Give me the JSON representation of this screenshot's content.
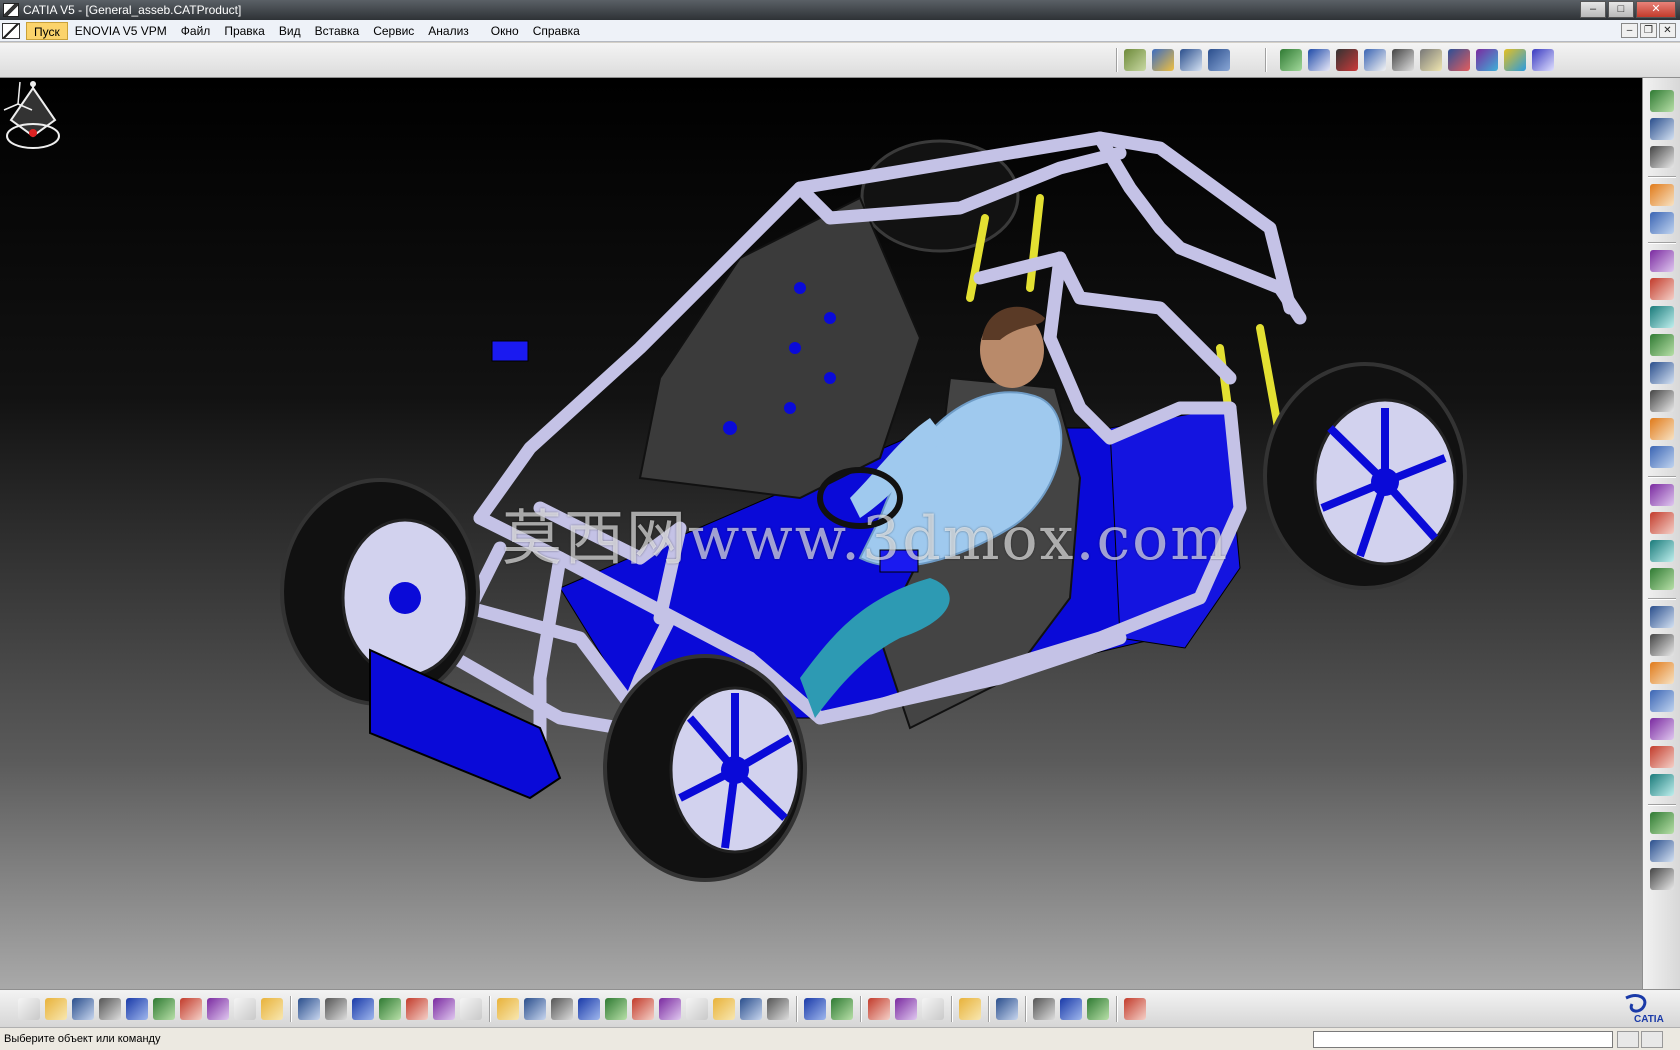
{
  "window": {
    "title": "CATIA V5 - [General_asseb.CATProduct]",
    "controls": {
      "minimize": "–",
      "maximize": "□",
      "close": "✕"
    },
    "mdi_controls": {
      "minimize": "–",
      "restore": "❐",
      "close": "✕"
    }
  },
  "menu": {
    "items": [
      "Пуск",
      "ENOVIA V5 VPM",
      "Файл",
      "Правка",
      "Вид",
      "Вставка",
      "Сервис",
      "Анализ",
      "Окно",
      "Справка"
    ],
    "active": "Пуск"
  },
  "viewport": {
    "watermark": "莫西网www.3dmox.com",
    "background_colors": {
      "top": "#000000",
      "bottom": "#a9a9a9"
    },
    "model_colors": {
      "tube": "#c4c2e6",
      "panel": "#0a0ad8",
      "seat": "#3b3b3b",
      "tire": "#121212",
      "shock": "#e3e032",
      "figure_shirt": "#9fc9ee",
      "figure_pants": "#2d9ab3"
    }
  },
  "top_toolbar": {
    "icons": [
      "product-structure-icon",
      "component-icon",
      "existing-component-icon",
      "product-icon",
      "measure-icon",
      "box-icon",
      "constraint-icon",
      "fix-icon",
      "snap-icon",
      "manipulate-icon",
      "clash-icon",
      "explode-icon",
      "update-icon",
      "scene-icon"
    ]
  },
  "right_toolbar": {
    "icons": [
      "sketch-gear-icon",
      "part-doc-icon",
      "product-doc-icon",
      "select-arrow-icon",
      "manipulation-icon",
      "new-component-icon",
      "new-product-icon",
      "new-part-icon",
      "existing-component-icon",
      "replace-component-icon",
      "graph-tree-icon",
      "generate-numbering-icon",
      "selective-load-icon",
      "manage-representation-icon",
      "multi-instantiation-icon",
      "fast-multi-instantiation-icon",
      "reuse-pattern-icon",
      "coincidence-icon",
      "contact-icon",
      "offset-icon",
      "angle-icon",
      "fix-component-icon",
      "fix-together-icon",
      "quick-constraint-icon",
      "flexible-icon",
      "change-constraint-icon",
      "reuse-constraint-icon"
    ]
  },
  "bottom_toolbar": {
    "icons": [
      "new-file-icon",
      "open-folder-icon",
      "save-icon",
      "print-icon",
      "cut-icon",
      "copy-icon",
      "paste-icon",
      "undo-icon",
      "redo-icon",
      "whats-this-icon",
      "formula-icon",
      "comment-icon",
      "knowledge-icon",
      "table-icon",
      "hierarchy-icon",
      "lock-icon",
      "catalog-icon",
      "fly-mode-icon",
      "fit-all-icon",
      "pan-icon",
      "rotate-icon",
      "zoom-in-icon",
      "zoom-out-icon",
      "normal-view-icon",
      "iso-view-icon",
      "render-style-icon",
      "hide-show-icon",
      "swap-visible-icon",
      "snapshot-camera-icon",
      "capture-icon",
      "measure-between-icon",
      "measure-item-icon",
      "inertia-icon",
      "update-link-icon",
      "section-icon",
      "materials-icon",
      "texture-icon",
      "color-icon",
      "grid-icon"
    ],
    "logo": "CATIA"
  },
  "status": {
    "prompt": "Выберите объект или команду",
    "command_value": ""
  }
}
